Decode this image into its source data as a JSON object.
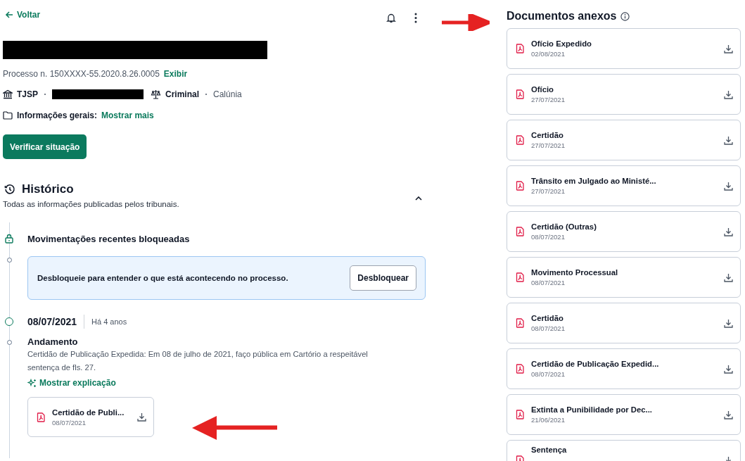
{
  "header": {
    "back_link": "Voltar"
  },
  "case": {
    "process_label": "Processo n. 150XXXX-55.2020.8.26.0005",
    "show_link": "Exibir",
    "court": "TJSP",
    "area": "Criminal",
    "subject": "Calúnia",
    "info_label": "Informações gerais:",
    "info_link": "Mostrar mais",
    "action_button": "Verificar situação"
  },
  "history": {
    "title": "Histórico",
    "subtitle": "Todas as informações publicadas pelos tribunais.",
    "expanded": true,
    "locked": {
      "title": "Movimentações recentes bloqueadas",
      "message": "Desbloqueie para entender o que está acontecendo no processo.",
      "button": "Desbloquear"
    },
    "entries": [
      {
        "date": "08/07/2021",
        "relative": "Há 4 anos",
        "title": "Andamento",
        "description": "Certidão de Publicação Expedida: Em 08 de julho de 2021, faço pública em Cartório a respeitável sentença de fls. 27.",
        "explain_link": "Mostrar explicação",
        "attachment": {
          "title": "Certidão de Publi...",
          "date": "08/07/2021"
        }
      }
    ]
  },
  "documents": {
    "title": "Documentos anexos",
    "items": [
      {
        "title": "Ofício Expedido",
        "date": "02/08/2021"
      },
      {
        "title": "Ofício",
        "date": "27/07/2021"
      },
      {
        "title": "Certidão",
        "date": "27/07/2021"
      },
      {
        "title": "Trânsito em Julgado ao Ministé...",
        "date": "27/07/2021"
      },
      {
        "title": "Certidão (Outras)",
        "date": "08/07/2021"
      },
      {
        "title": "Movimento Processual",
        "date": "08/07/2021"
      },
      {
        "title": "Certidão",
        "date": "08/07/2021"
      },
      {
        "title": "Certidão de Publicação Expedid...",
        "date": "08/07/2021"
      },
      {
        "title": "Extinta a Punibilidade por Dec...",
        "date": "21/06/2021"
      },
      {
        "title": "Sentença"
      }
    ]
  }
}
